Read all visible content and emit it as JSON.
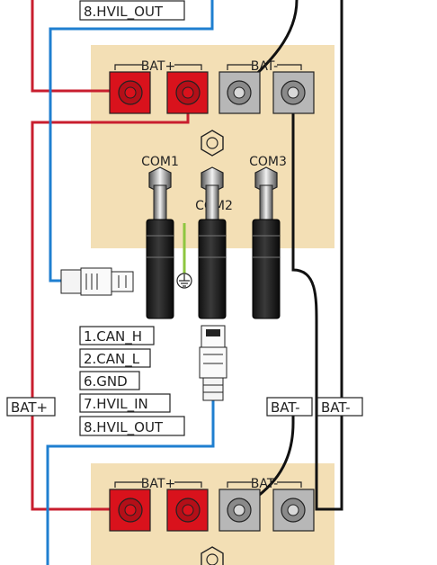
{
  "battery_top": {
    "bat_plus_label": "BAT+",
    "bat_minus_label": "BAT-",
    "hvil_out_label": "8.HVIL_OUT"
  },
  "com_ports": [
    "COM1",
    "COM2",
    "COM3"
  ],
  "can_pinout": [
    "1.CAN_H",
    "2.CAN_L",
    "6.GND",
    "7.HVIL_IN",
    "8.HVIL_OUT"
  ],
  "cable_labels": {
    "bat_plus": "BAT+",
    "bat_minus_1": "BAT-",
    "bat_minus_2": "BAT-"
  },
  "battery_bottom": {
    "bat_plus_label": "BAT+",
    "bat_minus_label": "BAT-"
  },
  "colors": {
    "panel": "#f3dfb5",
    "red_cable": "#c81e2e",
    "blue_cable": "#1f7fd0",
    "black_cable": "#111111",
    "red_terminal": "#d9121c",
    "grey_terminal": "#b7b7b7",
    "ground_wire": "#8dc63f"
  }
}
